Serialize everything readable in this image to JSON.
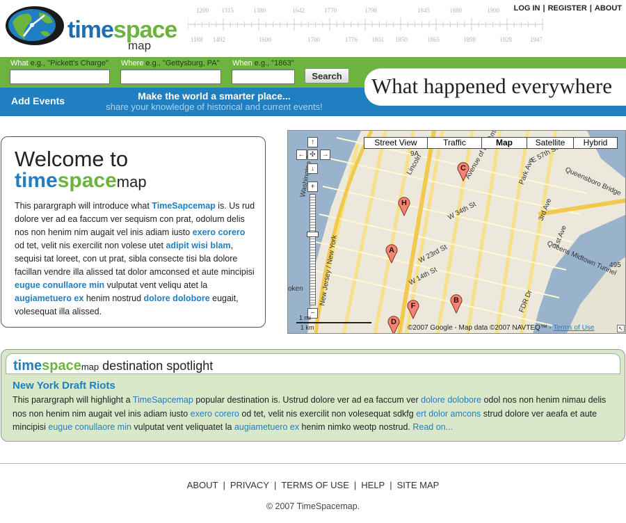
{
  "logo": {
    "time": "time",
    "space": "space",
    "map": "map"
  },
  "timeline": {
    "top_years": [
      "1200",
      "1315",
      "1380",
      "1642",
      "1770",
      "1798",
      "1845",
      "1880",
      "1900"
    ],
    "bottom_years": [
      "1188",
      "1492",
      "1600",
      "1700",
      "1776",
      "1801",
      "1850",
      "1865",
      "1898",
      "1928",
      "1947"
    ]
  },
  "toplinks": {
    "login": "LOG IN",
    "register": "REGISTER",
    "about": "ABOUT",
    "separator": "|"
  },
  "search": {
    "what_label": "What",
    "what_hint": " e.g., \"Pickett's Charge\"",
    "where_label": "Where",
    "where_hint": " e.g., \"Gettysburg, PA\"",
    "when_label": "When",
    "when_hint": " e.g., \"1863\"",
    "what_value": "",
    "where_value": "",
    "when_value": "",
    "button": "Search"
  },
  "bluebar": {
    "add_events": "Add Events",
    "tagline_1": "Make the world a smarter place...",
    "tagline_2": "share your knowledge of historical and current events!"
  },
  "slogan": "What happened everywhere",
  "welcome": {
    "heading_1": "Welcome to",
    "heading_time": "time",
    "heading_space": "space",
    "heading_map": "map",
    "p1": "This parargraph will introduce what ",
    "link1": "TimeSapcemap",
    "p2": " is. Us rud dolore ver ad ea faccum ver sequism con prat, odolum delis nos non henim nim augait vel inis adiam iusto ",
    "link2": "exero corero",
    "p3": " od tet, velit nis exercilit non volese utet ",
    "link3": "adipit wisi blam",
    "p4": ", sequisi tat loreet, con ut prat, sibla consecte tisi bla dolore facillan vendre illa alissed tat dolor amconsed et aute mincipisi ",
    "link4": "eugue conullaore min",
    "p5": " vulputat vent veliqu atet la ",
    "link5": "augiametuero ex",
    "p6": " henim nostrud ",
    "link6": "dolore dolobore",
    "p7": " eugait, volesequat illa alissed."
  },
  "map": {
    "types": [
      "Street View",
      "Traffic",
      "Map",
      "Satellite",
      "Hybrid"
    ],
    "active_type": "Map",
    "copyright": "©2007 Google - Map data ©2007 NAVTEQ™ - ",
    "terms": "Terms of Use",
    "scale_mi": "1 mi",
    "scale_km": "1 km",
    "markers": [
      "A",
      "B",
      "C",
      "D",
      "F",
      "H"
    ],
    "street_labels": [
      "Lincoln",
      "W 34th St",
      "W 23rd St",
      "W 14th St",
      "Park Ave",
      "3rd Ave",
      "1st Ave",
      "FDR Dr",
      "Queensboro Bridge",
      "Queens Midtown Tunnel",
      "Avenue of the Americas",
      "Washington St",
      "New Jersey / New York",
      "E 57th St",
      "9A",
      "495",
      "oken"
    ]
  },
  "spotlight": {
    "title_time": "time",
    "title_space": "space",
    "title_map": "map",
    "title_rest": " destination spotlight",
    "subheading": "New York Draft Riots",
    "s1": "This parargraph will highlight a ",
    "l1": "TimeSapcemap",
    "s2": " popular destination is. Ustrud dolore ver ad ea faccum ver ",
    "l2": "dolore dolobore",
    "s3": " odol nos non henim nimau delis nos non henim nim augait vel inis adiam iusto ",
    "l3": "exero corero",
    "s4": " od tet, velit nis exercilit non volesequat sdkfg ",
    "l4": "ert dolor amcons",
    "s5": " strud dolore ver aeafa et aute mincipisi ",
    "l5": "eugue conullaore min",
    "s6": " vulputat vent veliquatet la ",
    "l6": "augiametuero ex",
    "s7": " henim nimko weotp nostrud. ",
    "l7": "Read on..."
  },
  "footer": {
    "links": [
      "ABOUT",
      "PRIVACY",
      "TERMS OF USE",
      "HELP",
      "SITE MAP"
    ],
    "separator": "|",
    "copyright": "© 2007 TimeSpacemap."
  },
  "colors": {
    "brand_blue": "#1f7fc0",
    "brand_green": "#6db33f",
    "spotlight_bg": "#d8e8c8"
  }
}
